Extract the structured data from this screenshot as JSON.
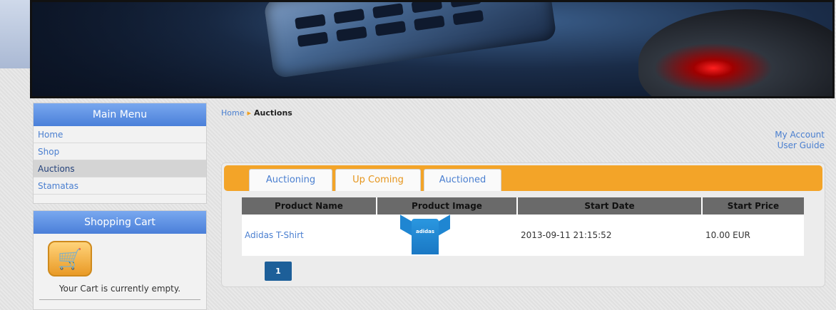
{
  "menu": {
    "title": "Main Menu",
    "items": [
      {
        "label": "Home"
      },
      {
        "label": "Shop"
      },
      {
        "label": "Auctions"
      },
      {
        "label": "Stamatas"
      }
    ]
  },
  "cart": {
    "title": "Shopping Cart",
    "empty_text": "Your Cart is currently empty."
  },
  "breadcrumb": {
    "home": "Home",
    "current": "Auctions"
  },
  "account": {
    "my_account": "My Account",
    "user_guide": "User Guide"
  },
  "tabs": [
    {
      "label": "Auctioning"
    },
    {
      "label": "Up Coming"
    },
    {
      "label": "Auctioned"
    }
  ],
  "active_tab": "Up Coming",
  "table": {
    "headers": [
      "Product Name",
      "Product Image",
      "Start Date",
      "Start Price"
    ],
    "rows": [
      {
        "name": "Adidas T-Shirt",
        "image_icon": "tshirt-image",
        "image_logo": "adidas",
        "start_date": "2013-09-11 21:15:52",
        "start_price": "10.00 EUR"
      }
    ]
  },
  "pagination": {
    "current_page": "1"
  },
  "colors": {
    "accent_orange": "#f3a428",
    "menu_header_blue": "#4a7fd9",
    "link_blue": "#4a7fd0",
    "pagination_blue": "#1d5f99"
  }
}
